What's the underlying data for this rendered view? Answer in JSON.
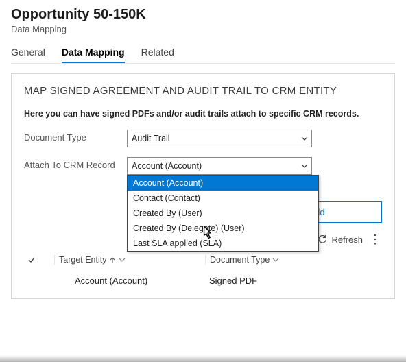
{
  "header": {
    "title": "Opportunity 50-150K",
    "subtitle": "Data Mapping"
  },
  "tabs": {
    "items": [
      {
        "label": "General",
        "active": false
      },
      {
        "label": "Data Mapping",
        "active": true
      },
      {
        "label": "Related",
        "active": false
      }
    ]
  },
  "section": {
    "title": "MAP SIGNED AGREEMENT AND AUDIT TRAIL TO CRM ENTITY",
    "description": "Here you can have signed PDFs and/or audit trails attach to specific CRM records."
  },
  "form": {
    "documentTypeLabel": "Document Type",
    "documentTypeValue": "Audit Trail",
    "attachLabel": "Attach To CRM Record",
    "attachValue": "Account (Account)",
    "attachOptions": [
      "Account (Account)",
      "Contact (Contact)",
      "Created By (User)",
      "Created By (Delegate) (User)",
      "Last SLA applied (SLA)"
    ]
  },
  "buttons": {
    "add": "Add",
    "refresh": "Refresh"
  },
  "table": {
    "columns": {
      "target": "Target Entity",
      "doc": "Document Type"
    },
    "rows": [
      {
        "target": "Account (Account)",
        "doc": "Signed PDF"
      }
    ]
  }
}
